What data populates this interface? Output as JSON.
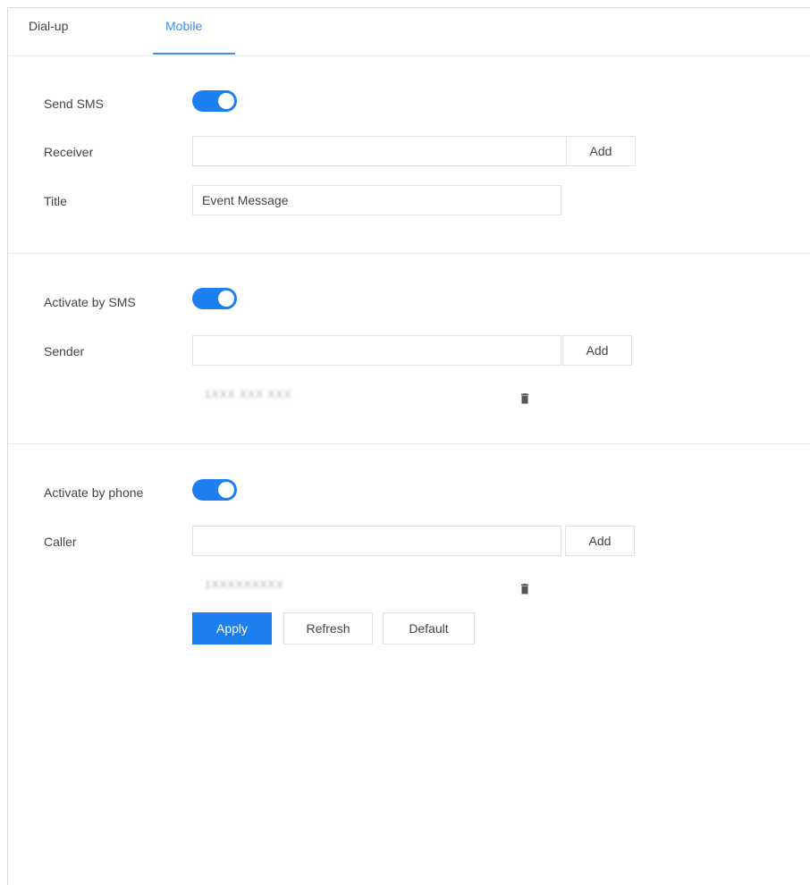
{
  "tabs": [
    {
      "label": "Dial-up"
    },
    {
      "label": "Mobile"
    }
  ],
  "active_tab": "Mobile",
  "accent_color": "#1e7ff0",
  "send_sms": {
    "label": "Send SMS",
    "enabled": true,
    "receiver": {
      "label": "Receiver",
      "value": "",
      "add_label": "Add"
    },
    "title": {
      "label": "Title",
      "value": "Event Message"
    }
  },
  "activate_sms": {
    "label": "Activate by SMS",
    "enabled": true,
    "sender": {
      "label": "Sender",
      "value": "",
      "add_label": "Add"
    },
    "entries": [
      {
        "number": "1ХХХ ХХХ ХХХ"
      }
    ]
  },
  "activate_phone": {
    "label": "Activate by phone",
    "enabled": true,
    "caller": {
      "label": "Caller",
      "value": "",
      "add_label": "Add"
    },
    "entries": [
      {
        "number": "1ХХХХХХХХХ"
      }
    ]
  },
  "actions": {
    "apply": "Apply",
    "refresh": "Refresh",
    "default": "Default"
  },
  "icons": {
    "delete": "trash-icon"
  }
}
